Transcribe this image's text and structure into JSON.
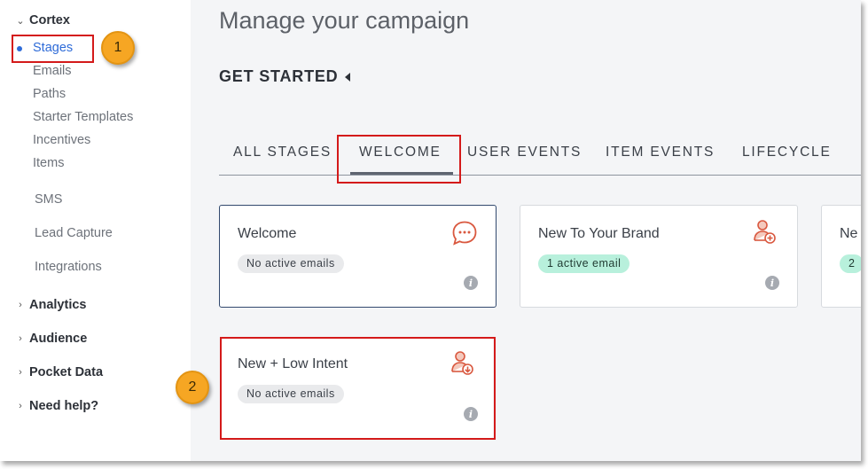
{
  "sidebar": {
    "cortex": "Cortex",
    "cortex_items": [
      "Stages",
      "Emails",
      "Paths",
      "Starter Templates",
      "Incentives",
      "Items"
    ],
    "other_items": [
      "SMS",
      "Lead Capture",
      "Integrations"
    ],
    "sections": [
      "Analytics",
      "Audience",
      "Pocket Data",
      "Need help?"
    ]
  },
  "callouts": [
    "1",
    "2"
  ],
  "main": {
    "title": "Manage your campaign",
    "get_started": "GET STARTED",
    "tabs": [
      "ALL STAGES",
      "WELCOME",
      "USER EVENTS",
      "ITEM EVENTS",
      "LIFECYCLE"
    ],
    "active_tab": "WELCOME"
  },
  "cards": [
    {
      "title": "Welcome",
      "status": "No active emails",
      "icon": "chat-bubble-icon"
    },
    {
      "title": "New To Your Brand",
      "status": "1 active email",
      "icon": "user-add-icon"
    },
    {
      "title": "Ne",
      "status": "2",
      "icon": ""
    },
    {
      "title": "New + Low Intent",
      "status": "No active emails",
      "icon": "user-download-icon"
    }
  ],
  "colors": {
    "accent_blue": "#2e6bd8",
    "annotation_red": "#d41a1a",
    "callout_orange": "#f6a623",
    "icon_red": "#d9583f",
    "active_pill_green": "#b8f0dc"
  }
}
